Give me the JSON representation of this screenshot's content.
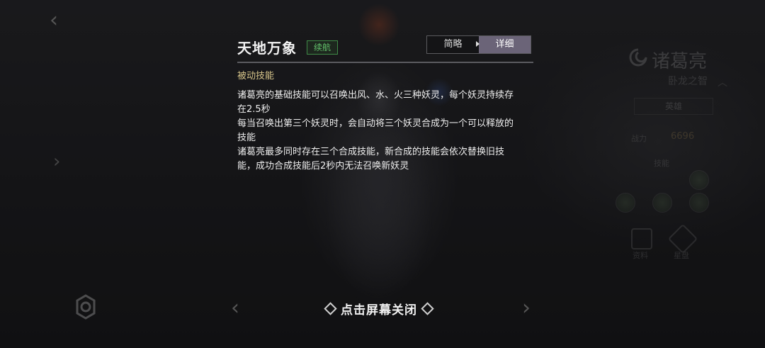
{
  "dialog": {
    "skill_name": "天地万象",
    "skill_tag": "续航",
    "tabs": [
      {
        "label": "简略",
        "active": false
      },
      {
        "label": "详细",
        "active": true
      }
    ],
    "skill_type": "被动技能",
    "description_lines": [
      "诸葛亮的基础技能可以召唤出风、水、火三种妖灵，每个妖灵持续存",
      "在2.5秒",
      "每当召唤出第三个妖灵时，会自动将三个妖灵合成为一个可以释放的",
      "技能",
      "诸葛亮最多同时存在三个合成技能，新合成的技能会依次替换旧技",
      "能，成功合成技能后2秒内无法召唤新妖灵"
    ]
  },
  "close_hint": "点击屏幕关闭",
  "background_panel": {
    "hero_name": "诸葛亮",
    "hero_title": "卧龙之智",
    "hero_tag": "英雄",
    "power_label": "战力",
    "power_value": "6696",
    "skills_label": "技能",
    "profile_label": "资料",
    "star_label": "星盘"
  },
  "icons": {
    "back": "chevron-left-icon",
    "prev": "chevron-left-icon",
    "next": "chevron-right-icon",
    "settings": "gear-icon",
    "close_hint_decor": "diamond-icon"
  },
  "colors": {
    "tag_green": "#63c36c",
    "active_tab": "#6b6478",
    "skill_type": "#d6c48a"
  }
}
